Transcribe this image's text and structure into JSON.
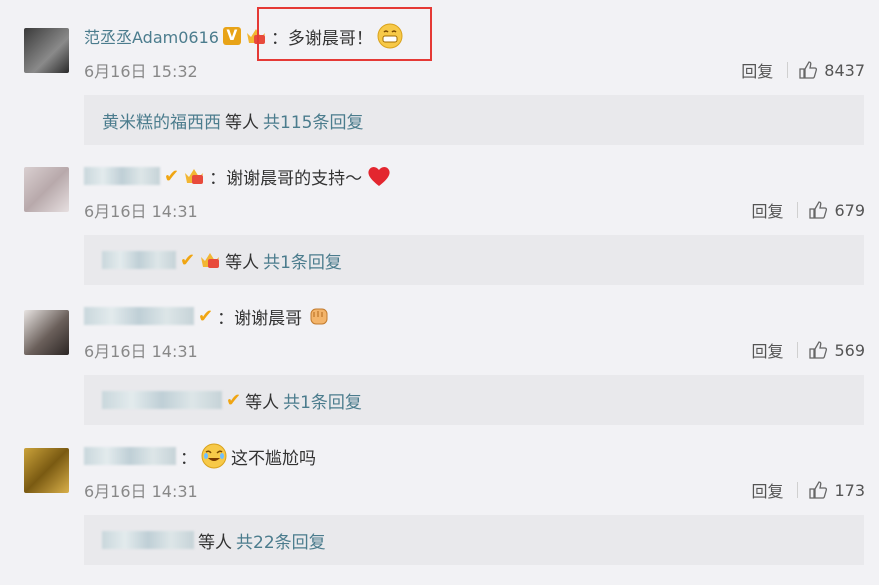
{
  "colors": {
    "link": "#4b7c8d",
    "highlight": "#e53935",
    "background": "#f2f2f5",
    "reply_box": "#e9e9ec"
  },
  "comments": [
    {
      "username": "范丞丞Adam0616",
      "verified": "V",
      "text": "：多谢晨哥！",
      "emoji": "grin-emoji",
      "date": "6月16日 15:32",
      "reply_label": "回复",
      "likes": "8437",
      "reply_preview": {
        "names": "黄米糕的福西西",
        "suffix": "等人",
        "total": "共115条回复"
      }
    },
    {
      "username": "",
      "text": "：谢谢晨哥的支持～",
      "emoji": "heart-emoji",
      "date": "6月16日 14:31",
      "reply_label": "回复",
      "likes": "679",
      "reply_preview": {
        "names": "",
        "suffix": "等人",
        "total": "共1条回复"
      }
    },
    {
      "username": "",
      "text": "：谢谢晨哥",
      "emoji": "fist-emoji",
      "date": "6月16日 14:31",
      "reply_label": "回复",
      "likes": "569",
      "reply_preview": {
        "names": "",
        "suffix": "等人",
        "total": "共1条回复"
      }
    },
    {
      "username": "",
      "text": "这不尴尬吗",
      "emoji": "crying-laugh-emoji",
      "date": "6月16日 14:31",
      "reply_label": "回复",
      "likes": "173",
      "reply_preview": {
        "names": "",
        "suffix": "等人",
        "total": "共22条回复"
      }
    }
  ]
}
